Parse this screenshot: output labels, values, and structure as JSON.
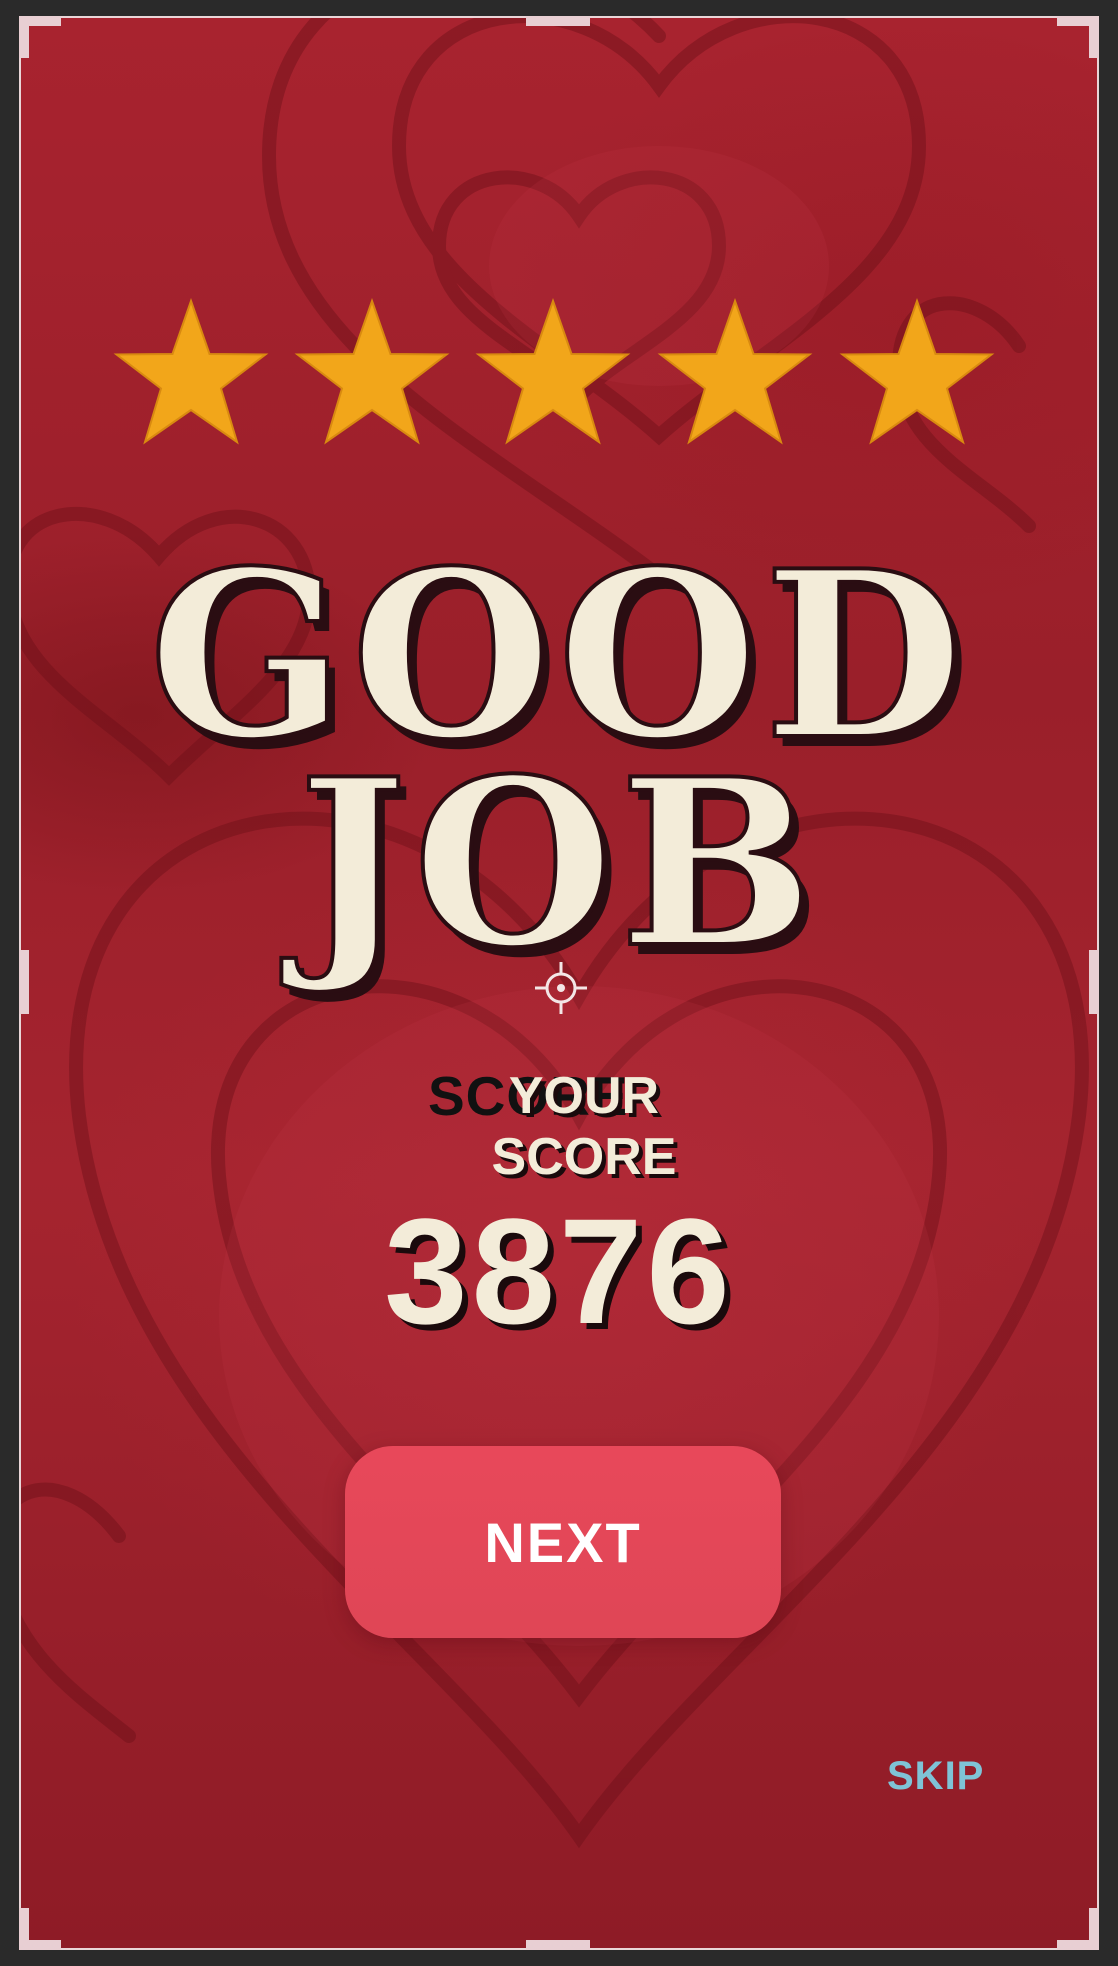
{
  "result": {
    "rating": {
      "stars_earned": 5,
      "stars_total": 5,
      "icon": "star-icon"
    },
    "title_line1": "GOOD",
    "title_line2": "JOB",
    "score_label_overlay": "SCORE",
    "score_label_line1": "YOUR",
    "score_label_line2": "SCORE",
    "score_value": "3876"
  },
  "actions": {
    "next_label": "NEXT",
    "skip_label": "SKIP"
  },
  "colors": {
    "background": "#a5242f",
    "star": "#f2a61a",
    "title_fill": "#f3ecd9",
    "title_shadow": "#2a0d12",
    "button": "#e4475a",
    "skip": "#7fc3d6"
  }
}
